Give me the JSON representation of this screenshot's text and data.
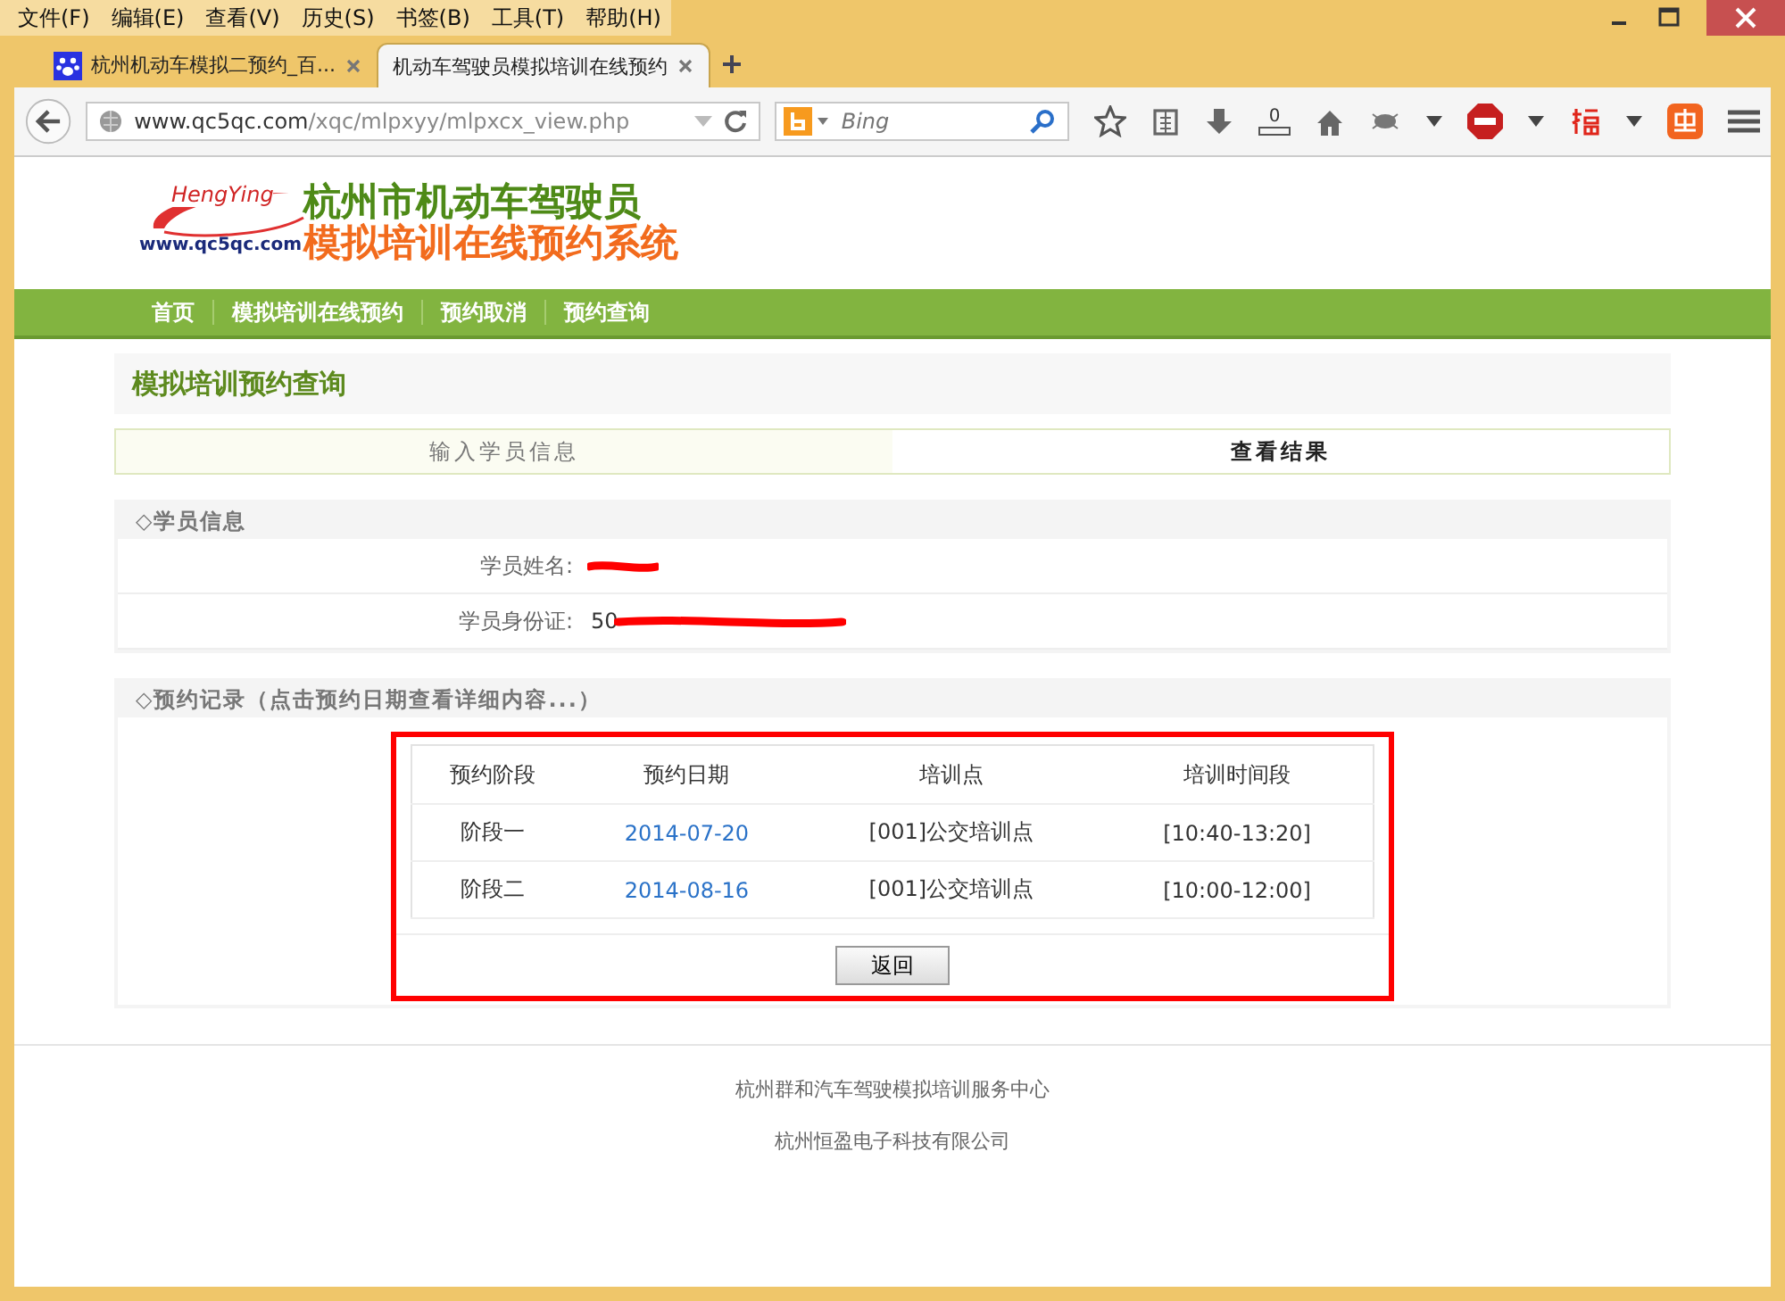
{
  "menu": [
    "文件(F)",
    "编辑(E)",
    "查看(V)",
    "历史(S)",
    "书签(B)",
    "工具(T)",
    "帮助(H)"
  ],
  "tabs": [
    {
      "label": "杭州机动车模拟二预约_百...",
      "selected": false
    },
    {
      "label": "机动车驾驶员模拟培训在线预约",
      "selected": true
    }
  ],
  "address": {
    "host": "www.qc5qc.com",
    "path": "/xqc/mlpxyy/mlpxcx_view.php"
  },
  "search": {
    "placeholder": "Bing"
  },
  "toolbar": {
    "download_count": "0"
  },
  "site": {
    "logo_brand": "HengYing",
    "logo_url": "www.qc5qc.com",
    "title_line1": "杭州市机动车驾驶员",
    "title_line2": "模拟培训在线预约系统"
  },
  "nav": [
    "首页",
    "模拟培训在线预约",
    "预约取消",
    "预约查询"
  ],
  "page_title": "模拟培训预约查询",
  "steps": [
    {
      "label": "输入学员信息",
      "selected": false
    },
    {
      "label": "查看结果",
      "selected": true
    }
  ],
  "student": {
    "heading": "◇学员信息",
    "fields": [
      {
        "label": "学员姓名:",
        "redacted": true
      },
      {
        "label": "学员身份证:",
        "value": "50",
        "redacted": true
      }
    ]
  },
  "records": {
    "heading": "◇预约记录（点击预约日期查看详细内容...）",
    "highlighted": true,
    "columns": [
      "预约阶段",
      "预约日期",
      "培训点",
      "培训时间段"
    ],
    "rows": [
      [
        "阶段一",
        "2014-07-20",
        "[001]公交培训点",
        "[10:40-13:20]"
      ],
      [
        "阶段二",
        "2014-08-16",
        "[001]公交培训点",
        "[10:00-12:00]"
      ]
    ],
    "button": "返回"
  },
  "footer": [
    "杭州群和汽车驾驶模拟培训服务中心",
    "杭州恒盈电子科技有限公司"
  ]
}
